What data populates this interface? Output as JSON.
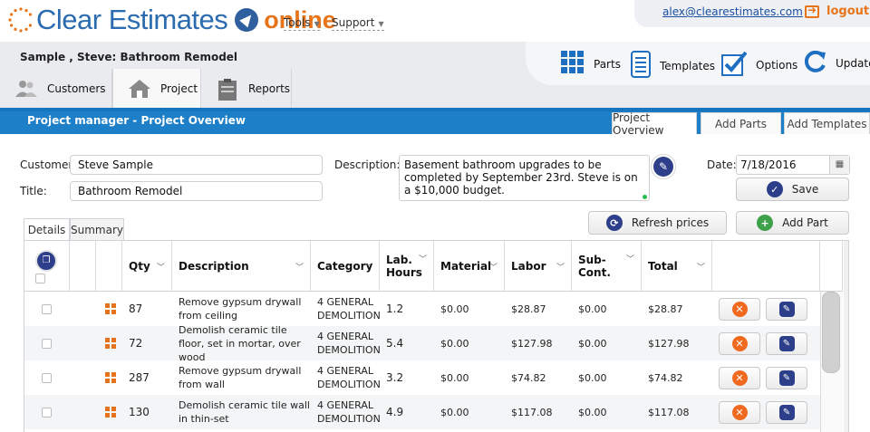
{
  "header": {
    "logo_clear": "Clear Estimates",
    "logo_online": "online",
    "menu_tools": "Tools",
    "menu_support": "Support",
    "email": "alex@clearestimates.com",
    "logout": "logout"
  },
  "project": {
    "title": "Sample , Steve: Bathroom Remodel",
    "nav": {
      "customers": "Customers",
      "project": "Project",
      "reports": "Reports"
    },
    "tools": {
      "parts": "Parts",
      "templates": "Templates",
      "options": "Options",
      "update": "Update"
    }
  },
  "bluebar": {
    "title": "Project manager - Project Overview",
    "tabs": {
      "overview": "Project Overview",
      "add_parts": "Add Parts",
      "add_templates": "Add Templates"
    }
  },
  "form": {
    "customer_label": "Customer:",
    "customer_value": "Steve Sample",
    "title_label": "Title:",
    "title_value": "Bathroom Remodel",
    "description_label": "Description:",
    "description_value": "Basement bathroom upgrades to be completed by September 23rd. Steve is on a $10,000 budget.",
    "date_label": "Date:",
    "date_value": "7/18/2016",
    "save": "Save",
    "refresh_prices": "Refresh prices",
    "add_part": "Add Part"
  },
  "subtabs": {
    "details": "Details",
    "summary": "Summary"
  },
  "table": {
    "headers": {
      "qty": "Qty",
      "description": "Description",
      "category": "Category",
      "lab_hours": "Lab. Hours",
      "material": "Material",
      "labor": "Labor",
      "subcont": "Sub-Cont.",
      "total": "Total"
    },
    "rows": [
      {
        "qty": "87",
        "description": "Remove gypsum drywall from ceiling",
        "category": "4 GENERAL DEMOLITION",
        "hours": "1.2",
        "material": "$0.00",
        "labor": "$28.87",
        "subcont": "$0.00",
        "total": "$28.87"
      },
      {
        "qty": "72",
        "description": "Demolish ceramic tile floor, set in mortar, over wood",
        "category": "4 GENERAL DEMOLITION",
        "hours": "5.4",
        "material": "$0.00",
        "labor": "$127.98",
        "subcont": "$0.00",
        "total": "$127.98"
      },
      {
        "qty": "287",
        "description": "Remove gypsum drywall from wall",
        "category": "4 GENERAL DEMOLITION",
        "hours": "3.2",
        "material": "$0.00",
        "labor": "$74.82",
        "subcont": "$0.00",
        "total": "$74.82"
      },
      {
        "qty": "130",
        "description": "Demolish ceramic tile wall in thin-set",
        "category": "4 GENERAL DEMOLITION",
        "hours": "4.9",
        "material": "$0.00",
        "labor": "$117.08",
        "subcont": "$0.00",
        "total": "$117.08"
      }
    ]
  },
  "colors": {
    "brand_blue": "#2b6cb0",
    "brand_orange": "#e8741a",
    "bar_blue": "#1c7fc8",
    "icon_navy": "#2d3f8a",
    "delete_orange": "#ef6a1f"
  },
  "icons": [
    "sun-logo-icon",
    "compass-icon",
    "logout-icon",
    "customers-icon",
    "house-icon",
    "clipboard-icon",
    "parts-grid-icon",
    "templates-icon",
    "options-checkbox-icon",
    "update-refresh-icon",
    "pencil-icon",
    "calendar-icon",
    "save-check-icon",
    "refresh-icon",
    "add-plus-icon",
    "drag-handle-icon",
    "delete-icon",
    "edit-icon",
    "select-all-icon"
  ]
}
